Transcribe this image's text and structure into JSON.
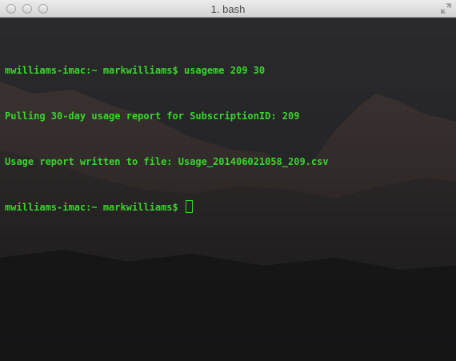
{
  "window": {
    "title": "1. bash"
  },
  "icons": {
    "close": "close-button",
    "minimize": "minimize-button",
    "zoom": "zoom-button",
    "fullscreen": "fullscreen-arrows-icon"
  },
  "colors": {
    "terminal_text": "#39d42e",
    "titlebar": "#e0e0e0",
    "background": "#1a1a1a"
  },
  "terminal": {
    "lines": [
      "mwilliams-imac:~ markwilliams$ usageme 209 30",
      "Pulling 30-day usage report for SubscriptionID: 209",
      "Usage report written to file: Usage_201406021058_209.csv"
    ],
    "prompt": "mwilliams-imac:~ markwilliams$ "
  }
}
